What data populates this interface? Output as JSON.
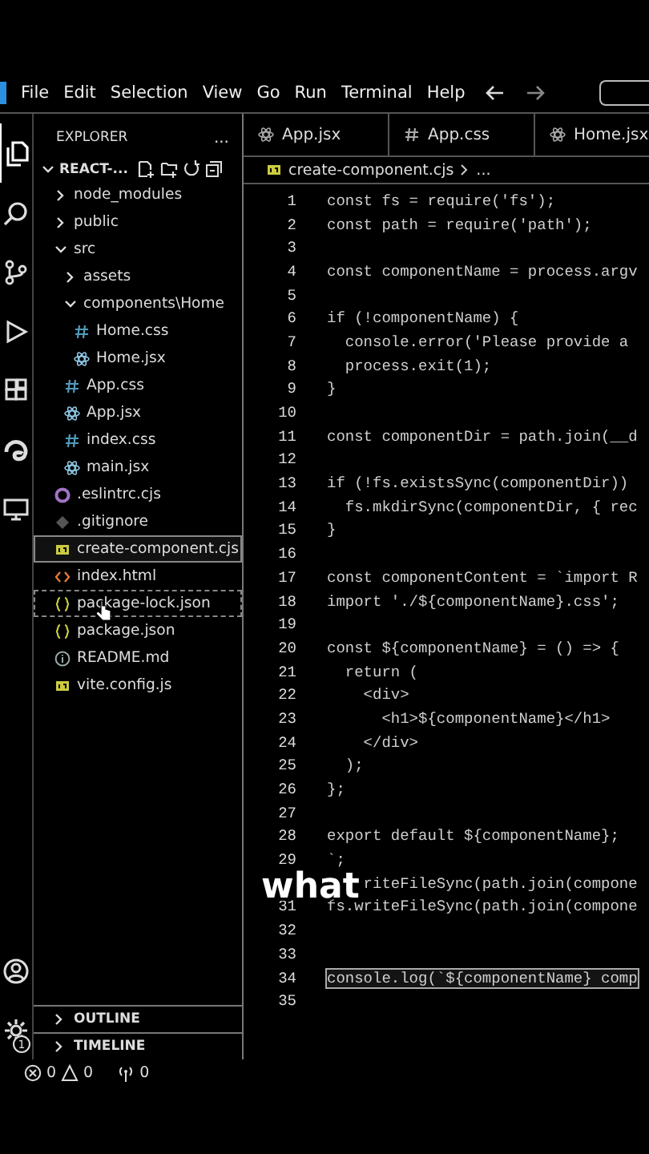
{
  "menu": {
    "items": [
      "File",
      "Edit",
      "Selection",
      "View",
      "Go",
      "Run",
      "Terminal",
      "Help"
    ]
  },
  "activity_bar": {
    "items": [
      {
        "kind": "files",
        "selected": true
      },
      {
        "kind": "search",
        "selected": false
      },
      {
        "kind": "source-control",
        "selected": false
      },
      {
        "kind": "run",
        "selected": false
      },
      {
        "kind": "extensions",
        "selected": false
      },
      {
        "kind": "swirl",
        "selected": false
      },
      {
        "kind": "remote",
        "selected": false
      }
    ],
    "bottom": [
      {
        "kind": "account"
      },
      {
        "kind": "settings",
        "badge": "1"
      }
    ]
  },
  "explorer": {
    "title": "EXPLORER",
    "more": "...",
    "project": "REACT-...",
    "tree": [
      {
        "name": "node_modules",
        "kind": "folder",
        "expanded": false,
        "selected": false,
        "hovered": false
      },
      {
        "name": "public",
        "kind": "folder",
        "expanded": false,
        "selected": false,
        "hovered": false
      },
      {
        "name": "src",
        "kind": "folder",
        "expanded": true,
        "selected": false,
        "hovered": false,
        "children": [
          {
            "name": "assets",
            "kind": "folder",
            "expanded": false,
            "selected": false,
            "hovered": false
          },
          {
            "name": "components\\Home",
            "kind": "folder",
            "expanded": true,
            "selected": false,
            "hovered": false,
            "children": [
              {
                "name": "Home.css",
                "kind": "css",
                "selected": false,
                "hovered": false
              },
              {
                "name": "Home.jsx",
                "kind": "react",
                "selected": false,
                "hovered": false
              }
            ]
          },
          {
            "name": "App.css",
            "kind": "css",
            "selected": false,
            "hovered": false
          },
          {
            "name": "App.jsx",
            "kind": "react",
            "selected": false,
            "hovered": false
          },
          {
            "name": "index.css",
            "kind": "css",
            "selected": false,
            "hovered": false
          },
          {
            "name": "main.jsx",
            "kind": "react",
            "selected": false,
            "hovered": false
          }
        ]
      },
      {
        "name": ".eslintrc.cjs",
        "kind": "eslint",
        "selected": false,
        "hovered": false
      },
      {
        "name": ".gitignore",
        "kind": "git",
        "selected": false,
        "hovered": false
      },
      {
        "name": "create-component.cjs",
        "kind": "js",
        "selected": true,
        "hovered": false
      },
      {
        "name": "index.html",
        "kind": "html",
        "selected": false,
        "hovered": false
      },
      {
        "name": "package-lock.json",
        "kind": "json",
        "selected": false,
        "hovered": true
      },
      {
        "name": "package.json",
        "kind": "json",
        "selected": false,
        "hovered": false
      },
      {
        "name": "README.md",
        "kind": "info",
        "selected": false,
        "hovered": false
      },
      {
        "name": "vite.config.js",
        "kind": "js",
        "selected": false,
        "hovered": false
      }
    ]
  },
  "sections": [
    "OUTLINE",
    "TIMELINE"
  ],
  "tabs": [
    {
      "label": "App.jsx",
      "kind": "react"
    },
    {
      "label": "App.css",
      "kind": "css"
    },
    {
      "label": "Home.jsx",
      "kind": "react"
    }
  ],
  "breadcrumb": {
    "kind": "js",
    "file": "create-component.cjs",
    "rest": "..."
  },
  "code": [
    {
      "num": "1",
      "text": "const fs = require('fs');",
      "selected": false
    },
    {
      "num": "2",
      "text": "const path = require('path');",
      "selected": false
    },
    {
      "num": "3",
      "selected": false
    },
    {
      "num": "4",
      "text": "const componentName = process.argv",
      "selected": false
    },
    {
      "num": "5",
      "selected": false
    },
    {
      "num": "6",
      "text": "if (!componentName) {",
      "selected": false
    },
    {
      "num": "7",
      "text": "  console.error('Please provide a",
      "selected": false
    },
    {
      "num": "8",
      "text": "  process.exit(1);",
      "selected": false
    },
    {
      "num": "9",
      "text": "}",
      "selected": false
    },
    {
      "num": "10",
      "selected": false
    },
    {
      "num": "11",
      "text": "const componentDir = path.join(__d",
      "selected": false
    },
    {
      "num": "12",
      "selected": false
    },
    {
      "num": "13",
      "text": "if (!fs.existsSync(componentDir))",
      "selected": false
    },
    {
      "num": "14",
      "text": "  fs.mkdirSync(componentDir, { rec",
      "selected": false
    },
    {
      "num": "15",
      "text": "}",
      "selected": false
    },
    {
      "num": "16",
      "selected": false
    },
    {
      "num": "17",
      "text": "const componentContent = `import R",
      "selected": false
    },
    {
      "num": "18",
      "text": "import './${componentName}.css';",
      "selected": false
    },
    {
      "num": "19",
      "selected": false
    },
    {
      "num": "20",
      "text": "const ${componentName} = () => {",
      "selected": false
    },
    {
      "num": "21",
      "text": "  return (",
      "selected": false
    },
    {
      "num": "22",
      "text": "    <div>",
      "selected": false
    },
    {
      "num": "23",
      "text": "      <h1>${componentName}</h1>",
      "selected": false
    },
    {
      "num": "24",
      "text": "    </div>",
      "selected": false
    },
    {
      "num": "25",
      "text": "  );",
      "selected": false
    },
    {
      "num": "26",
      "text": "};",
      "selected": false
    },
    {
      "num": "27",
      "selected": false
    },
    {
      "num": "28",
      "text": "export default ${componentName};",
      "selected": false
    },
    {
      "num": "29",
      "text": "`;",
      "selected": false
    },
    {
      "text": "    riteFileSync(path.join(compone",
      "selected": false
    },
    {
      "num": "31",
      "text": "fs.writeFileSync(path.join(compone",
      "selected": false
    },
    {
      "num": "32",
      "selected": false
    },
    {
      "num": "33",
      "selected": false
    },
    {
      "num": "34",
      "text": "console.log(`${componentName} comp",
      "selected": true
    },
    {
      "num": "35",
      "selected": false
    }
  ],
  "status": {
    "errors": "0",
    "warnings": "0",
    "ports": "0"
  },
  "caption": "what"
}
